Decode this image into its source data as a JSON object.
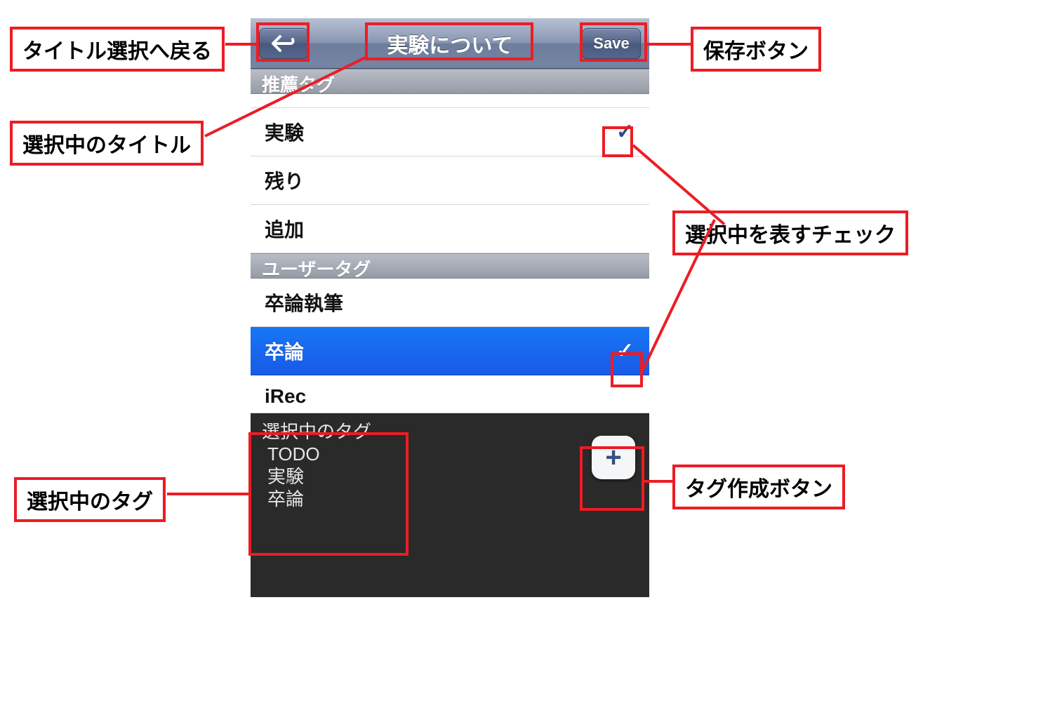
{
  "navbar": {
    "title": "実験について",
    "save_label": "Save"
  },
  "sections": {
    "recommended": "推薦タグ",
    "user": "ユーザータグ"
  },
  "rec_tags": [
    "実験",
    "残り",
    "追加"
  ],
  "user_tags": [
    "卒論執筆",
    "卒論",
    "iRec"
  ],
  "selected_panel_title": "選択中のタグ",
  "selected_tags": [
    "TODO",
    "実験",
    "卒論"
  ],
  "add_btn_glyph": "+",
  "callouts": {
    "back": "タイトル選択へ戻る",
    "title": "選択中のタイトル",
    "save": "保存ボタン",
    "check": "選択中を表すチェック",
    "selpanel": "選択中のタグ",
    "addbtn": "タグ作成ボタン"
  }
}
